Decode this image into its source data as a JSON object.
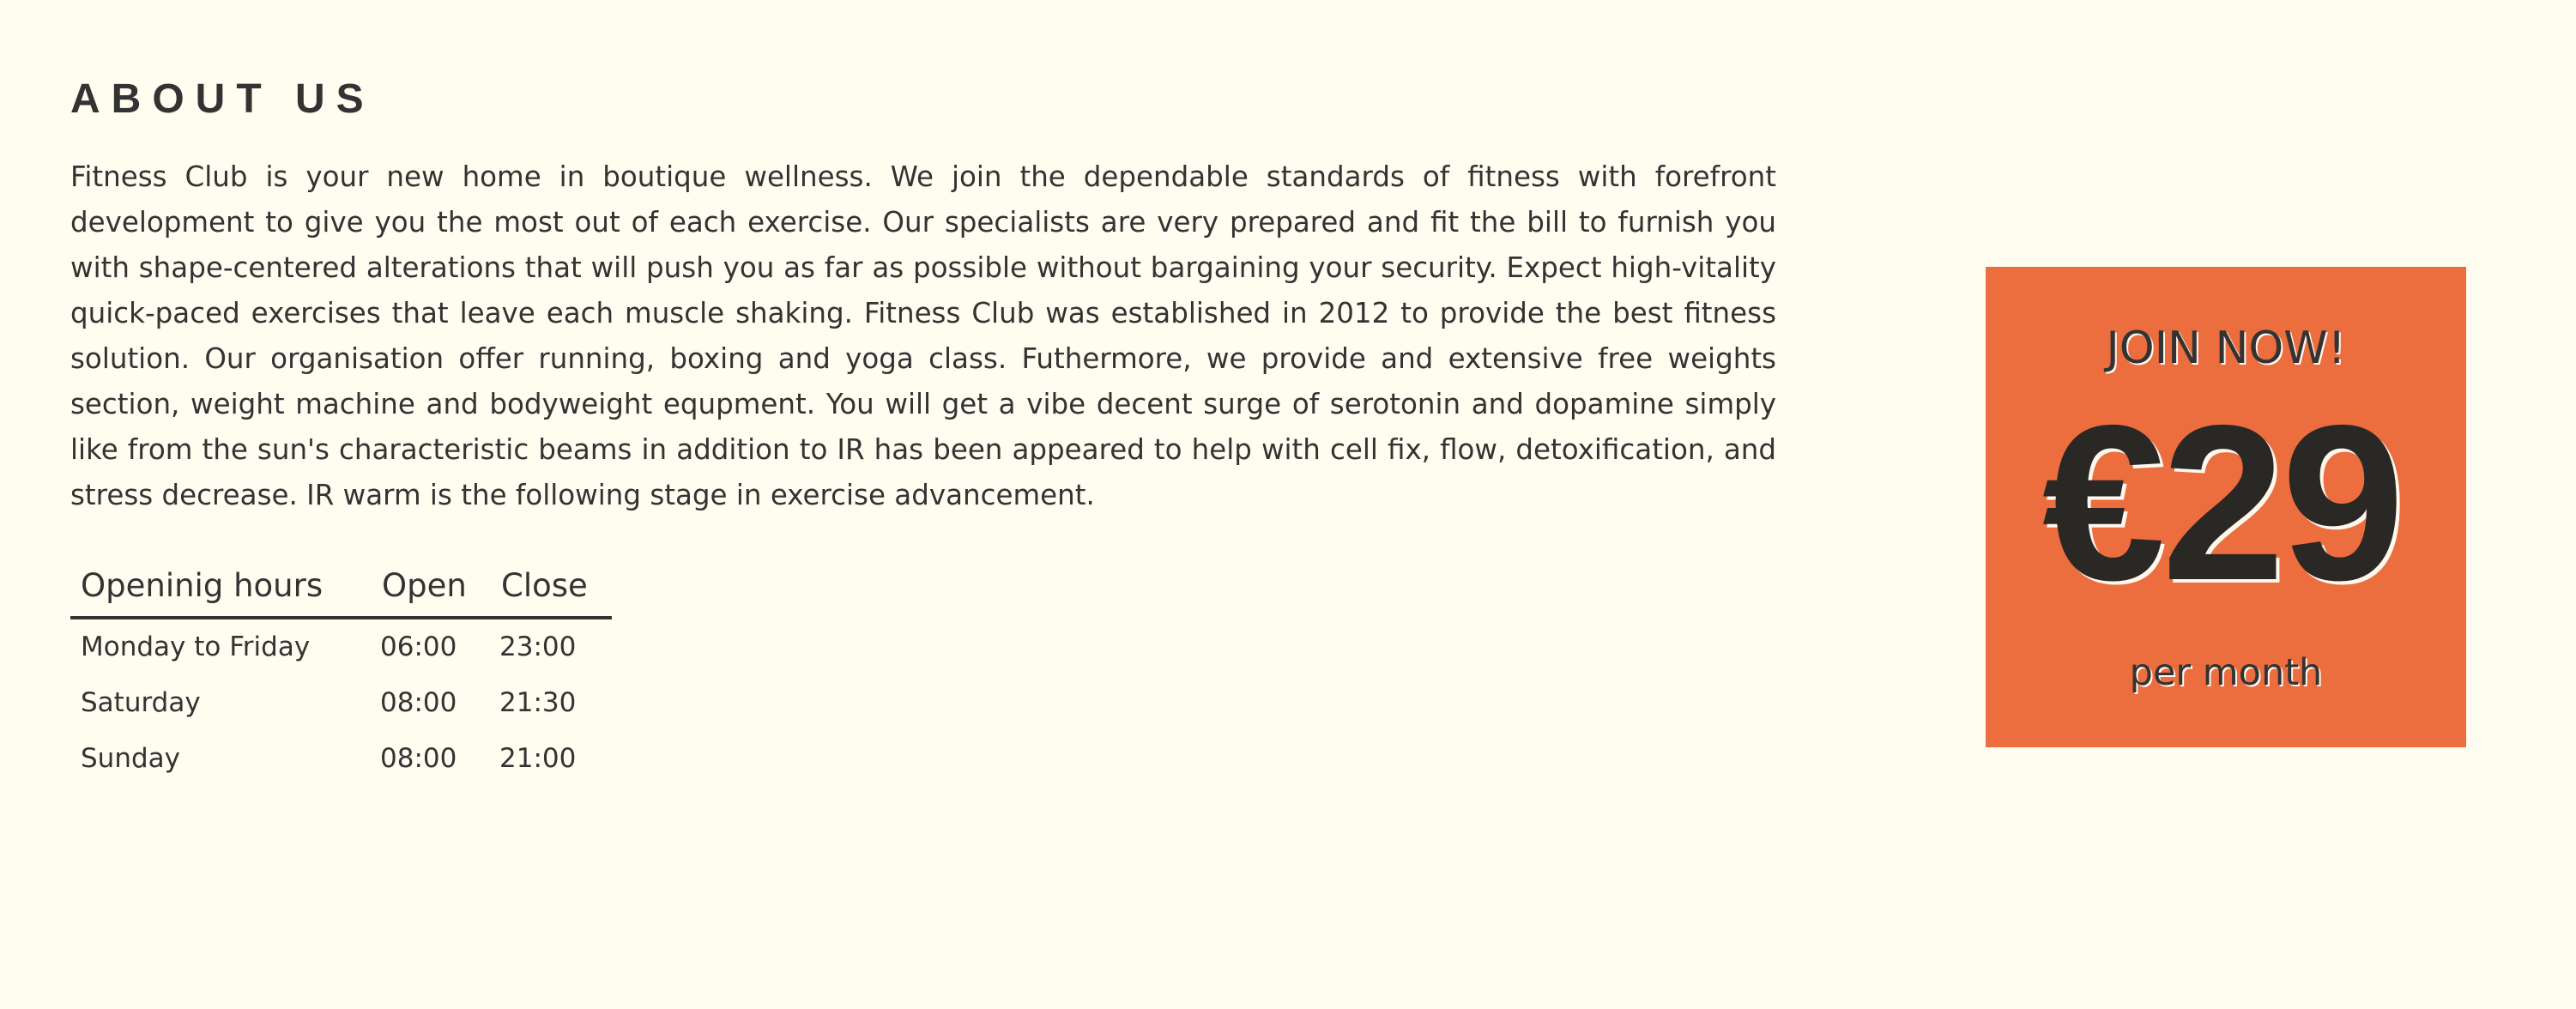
{
  "colors": {
    "page_background": "#fffdf0",
    "text": "#333333",
    "promo_background": "#ec6d3e",
    "promo_price_text": "#2a2825"
  },
  "about": {
    "heading": "ABOUT US",
    "body": "Fitness Club is your new home in boutique wellness. We join the dependable standards of fitness with forefront development to give you the most out of each exercise. Our specialists are very prepared and fit the bill to furnish you with shape-centered alterations that will push you as far as possible without bargaining your security. Expect high-vitality quick-paced exercises that leave each muscle shaking. Fitness Club was established in 2012 to provide the best fitness solution. Our organisation offer running, boxing and yoga class. Futhermore, we provide and extensive free weights section, weight machine and bodyweight equpment. You will get a vibe decent surge of serotonin and dopamine simply like from the sun's characteristic beams in addition to IR has been appeared to help with cell fix, flow, detoxification, and stress decrease. IR warm is the following stage in exercise advancement."
  },
  "hours": {
    "headers": [
      "Openinig hours",
      "Open",
      "Close"
    ],
    "rows": [
      {
        "day": "Monday to Friday",
        "open": "06:00",
        "close": "23:00"
      },
      {
        "day": "Saturday",
        "open": "08:00",
        "close": "21:30"
      },
      {
        "day": "Sunday",
        "open": "08:00",
        "close": "21:00"
      }
    ]
  },
  "promo": {
    "cta": "JOIN NOW!",
    "price": "€29",
    "period": "per month"
  }
}
